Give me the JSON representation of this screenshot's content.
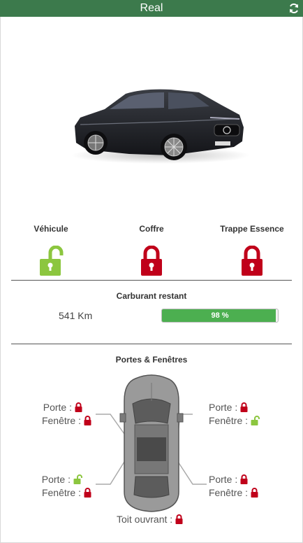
{
  "header": {
    "title": "Real"
  },
  "icons": {
    "refresh": "refresh-icon",
    "lock_locked": "lock-closed-icon",
    "lock_unlocked": "lock-open-icon"
  },
  "colors": {
    "header_bg": "#3c7a4c",
    "locked": "#c0001a",
    "unlocked": "#8cc63f",
    "fuel": "#4caf50"
  },
  "locks": [
    {
      "label": "Véhicule",
      "state": "unlocked"
    },
    {
      "label": "Coffre",
      "state": "locked"
    },
    {
      "label": "Trappe Essence",
      "state": "locked"
    }
  ],
  "fuel": {
    "title": "Carburant restant",
    "range": "541 Km",
    "percent_label": "98 %",
    "percent": 98
  },
  "openings": {
    "title": "Portes & Fenêtres",
    "front_left": {
      "door_label": "Porte :",
      "door": "locked",
      "window_label": "Fenêtre :",
      "window": "locked"
    },
    "front_right": {
      "door_label": "Porte :",
      "door": "locked",
      "window_label": "Fenêtre :",
      "window": "unlocked"
    },
    "rear_left": {
      "door_label": "Porte :",
      "door": "unlocked",
      "window_label": "Fenêtre :",
      "window": "locked"
    },
    "rear_right": {
      "door_label": "Porte :",
      "door": "locked",
      "window_label": "Fenêtre :",
      "window": "locked"
    },
    "sunroof": {
      "label": "Toit ouvrant :",
      "state": "locked"
    }
  }
}
